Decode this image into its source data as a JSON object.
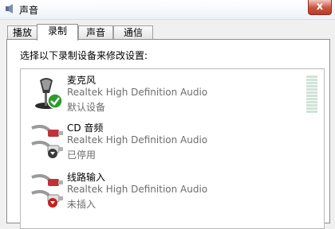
{
  "window": {
    "title": "声音",
    "close_glyph": "x"
  },
  "tabs": [
    {
      "label": "播放",
      "active": false
    },
    {
      "label": "录制",
      "active": true
    },
    {
      "label": "声音",
      "active": false
    },
    {
      "label": "通信",
      "active": false
    }
  ],
  "instruction": "选择以下录制设备来修改设置:",
  "devices": [
    {
      "name": "麦克风",
      "description": "Realtek High Definition Audio",
      "status": "默认设备",
      "icon": "microphone-icon",
      "badge": "default-check-badge"
    },
    {
      "name": "CD 音频",
      "description": "Realtek High Definition Audio",
      "status": "已停用",
      "icon": "rca-cable-icon",
      "badge": "disabled-down-arrow-badge"
    },
    {
      "name": "线路输入",
      "description": "Realtek High Definition Audio",
      "status": "未插入",
      "icon": "rca-cable-icon",
      "badge": "unplugged-red-badge"
    }
  ],
  "colors": {
    "check_green": "#2e9b2e",
    "unplugged_red": "#c42020",
    "cable_red": "#c0323a"
  }
}
